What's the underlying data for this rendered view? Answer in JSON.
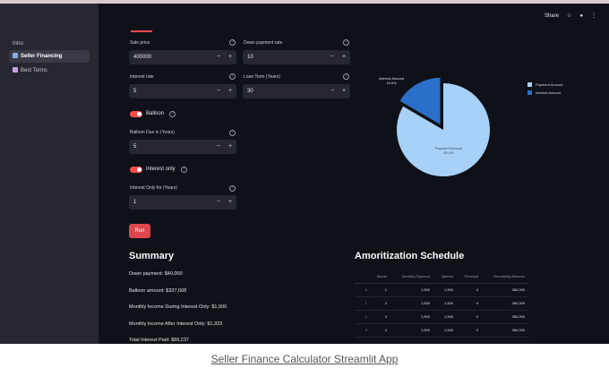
{
  "sidebar": {
    "items": [
      {
        "label": "Intro"
      },
      {
        "label": "Seller Financing"
      },
      {
        "label": "Best Terms"
      }
    ]
  },
  "header": {
    "share": "Share"
  },
  "inputs": {
    "sale_price": {
      "label": "Sale price",
      "value": "400000"
    },
    "down_payment_rate": {
      "label": "Down payment rate",
      "value": "10"
    },
    "interest_rate": {
      "label": "Interest rate",
      "value": "5"
    },
    "loan_term": {
      "label": "Loan Term (Years)",
      "value": "30"
    },
    "balloon_toggle": {
      "label": "Balloon"
    },
    "balloon_due": {
      "label": "Balloon Due in (Years)",
      "value": "5"
    },
    "interest_only_toggle": {
      "label": "Interest only"
    },
    "interest_only_for": {
      "label": "Interest Only for (Years)",
      "value": "1"
    }
  },
  "run_button": "Run",
  "summary": {
    "title": "Summary",
    "lines": [
      "Down payment: $40,000",
      "Balloon amount: $337,068",
      "Monthly Income During Interest Only: $1,500",
      "Monthly Income After Interest Only: $1,933",
      "Total Interest Paid: $89,237"
    ]
  },
  "chart_data": {
    "type": "pie",
    "slices": [
      {
        "label": "Payment Amount",
        "value": 83.4,
        "pct_label": "83.4%",
        "color": "#a8d1f7"
      },
      {
        "label": "Interest Amount",
        "value": 16.6,
        "pct_label": "16.6%",
        "color": "#2a6fc9"
      }
    ],
    "legend": [
      "Payment Amount",
      "Interest Amount"
    ],
    "legend_position": "top-right"
  },
  "amortization": {
    "title": "Amoritization Schedule",
    "columns": [
      "",
      "Month",
      "Monthly Payment",
      "Interest",
      "Principal",
      "Remaining Balance"
    ],
    "rows": [
      [
        "0",
        "1",
        "1,500",
        "1,500",
        "0",
        "360,000"
      ],
      [
        "1",
        "2",
        "1,500",
        "1,500",
        "0",
        "360,000"
      ],
      [
        "2",
        "3",
        "1,500",
        "1,500",
        "0",
        "360,000"
      ],
      [
        "3",
        "4",
        "1,500",
        "1,500",
        "0",
        "360,000"
      ]
    ]
  },
  "caption": "Seller Finance Calculator Streamlit App",
  "colors": {
    "accent": "#ff4b4b",
    "background": "#0e1117",
    "sidebar": "#262730"
  }
}
